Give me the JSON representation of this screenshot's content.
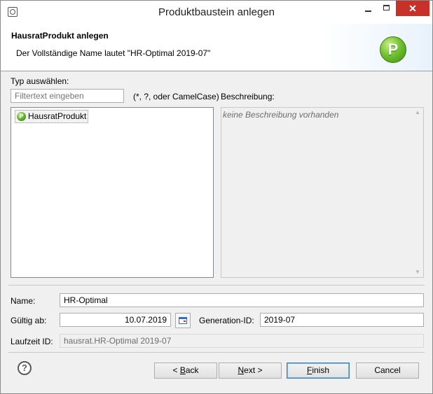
{
  "window": {
    "title": "Produktbaustein anlegen",
    "close_glyph": "✕"
  },
  "banner": {
    "title": "HausratProdukt anlegen",
    "message": "Der Vollständige Name lautet \"HR-Optimal 2019-07\"",
    "icon_letter": "P"
  },
  "type_section": {
    "label": "Typ auswählen:",
    "filter_placeholder": "Filtertext eingeben",
    "filter_hint": "(*, ?, oder CamelCase)",
    "items": [
      {
        "label": "HausratProdukt",
        "icon_letter": "P"
      }
    ]
  },
  "description_section": {
    "label": "Beschreibung:",
    "text": "keine Beschreibung vorhanden"
  },
  "form": {
    "name_label": "Name:",
    "name_value": "HR-Optimal",
    "valid_from_label": "Gültig ab:",
    "valid_from_value": "10.07.2019",
    "generation_label": "Generation-ID:",
    "generation_value": "2019-07",
    "runtime_label": "Laufzeit ID:",
    "runtime_value": "hausrat.HR-Optimal 2019-07"
  },
  "buttons": {
    "help_glyph": "?",
    "back_prefix": "< ",
    "back_mnemonic": "B",
    "back_rest": "ack",
    "next_mnemonic": "N",
    "next_rest": "ext >",
    "finish_mnemonic": "F",
    "finish_rest": "inish",
    "cancel_label": "Cancel"
  },
  "colors": {
    "close_button": "#c7312a",
    "product_icon": "#72c232",
    "default_button_border": "#3c7fb1"
  }
}
